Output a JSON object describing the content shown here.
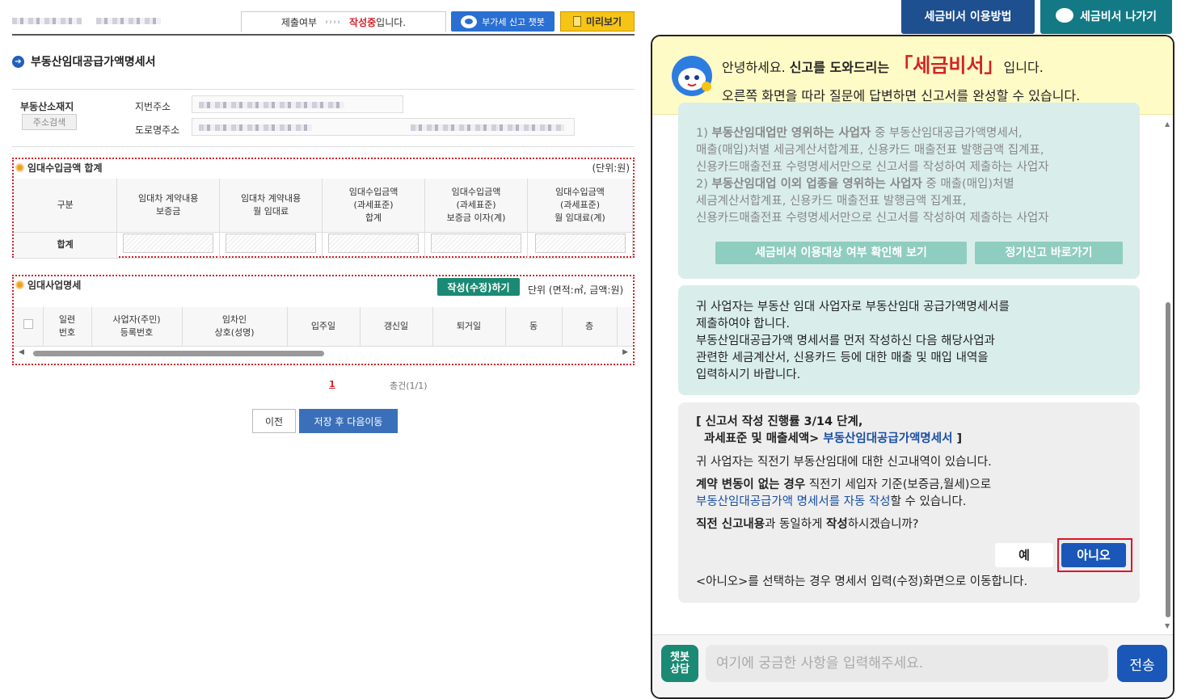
{
  "left": {
    "topbar": {
      "submit_label": "제출여부",
      "arrows": "››››",
      "status_red": "작성중",
      "status_suffix": "입니다.",
      "chatbot_button": "부가세 신고 챗봇",
      "preview_button": "미리보기"
    },
    "page_title": "부동산임대공급가액명세서",
    "address": {
      "location_label": "부동산소재지",
      "search_button": "주소검색",
      "lot_label": "지번주소",
      "road_label": "도로명주소"
    },
    "income_total": {
      "title": "임대수입금액 합계",
      "unit": "(단위:원)",
      "headers": [
        "구분",
        "임대차 계약내용\n보증금",
        "임대차 계약내용\n월 임대료",
        "임대수입금액\n(과세표준)\n합계",
        "임대수입금액\n(과세표준)\n보증금 이자(계)",
        "임대수입금액\n(과세표준)\n월 임대료(계)"
      ],
      "row_label": "합계"
    },
    "business_detail": {
      "title": "임대사업명세",
      "write_button": "작성(수정)하기",
      "unit": "단위 (면적:㎡, 금액:원)",
      "headers": [
        "일련\n번호",
        "사업자(주민)\n등록번호",
        "임차인\n상호(성명)",
        "입주일",
        "갱신일",
        "퇴거일",
        "동",
        "층"
      ]
    },
    "pagination": {
      "page": "1",
      "count": "총건(1/1)"
    },
    "prev_button": "이전",
    "next_button": "저장 후 다음이동"
  },
  "right": {
    "top_tabs": [
      "세금비서 이용방법",
      "세금비서 나가기"
    ],
    "banner": {
      "greet": "안녕하세요.",
      "bold": "신고를 도와드리는",
      "brand": "「세금비서」",
      "tail": "입니다.",
      "line2": "오른쪽 화면을 따라 질문에 답변하면 신고서를 완성할 수 있습니다."
    },
    "msg1": {
      "l1a": "1) ",
      "l1b": "부동산임대업만 영위하는 사업자",
      "l1c": " 중 부동산임대공급가액명세서,",
      "l2": "매출(매입)처별 세금계산서합계표, 신용카드 매출전표 발행금액 집계표,",
      "l3": "신용카드매출전표 수령명세서만으로 신고서를 작성하여 제출하는 사업자",
      "l4a": "2) ",
      "l4b": "부동산임대업 이외 업종을 영위하는 사업자",
      "l4c": " 중 매출(매입)처별",
      "l5": "세금계산서합계표, 신용카드 매출전표 발행금액 집계표,",
      "l6": "신용카드매출전표 수령명세서만으로 신고서를 작성하여 제출하는 사업자",
      "btn_check": "세금비서 이용대상 여부 확인해 보기",
      "btn_regular": "정기신고 바로가기"
    },
    "msg2": {
      "l1": "귀 사업자는 부동산 임대 사업자로 부동산임대 공급가액명세서를",
      "l2": "제출하여야 합니다.",
      "l3": "부동산임대공급가액 명세서를 먼저 작성하신 다음 해당사업과",
      "l4": "관련한 세금계산서, 신용카드 등에 대한 매출 및 매입 내역을",
      "l5": "입력하시기 바랍니다."
    },
    "msg3": {
      "step1": "[ 신고서 작성 진행률 3/14 단계,",
      "step2a": "과세표준 및 매출세액> ",
      "step2b": "부동산임대공급가액명세서",
      "step2c": " ]",
      "p1": "귀 사업자는 직전기 부동산임대에 대한 신고내역이 있습니다.",
      "p2a": "계약 변동이 없는 경우",
      "p2b": " 직전기 세입자 기준(보증금,월세)으로",
      "p3a": "부동산임대공급가액 명세서를 자동 작성",
      "p3b": "할 수 있습니다.",
      "p4a": "직전 신고내용",
      "p4b": "과 동일하게 ",
      "p4c": "작성",
      "p4d": "하시겠습니까?",
      "yes": "예",
      "no": "아니오",
      "note": "<아니오>를 선택하는 경우 명세서 입력(수정)화면으로 이동합니다."
    },
    "input": {
      "chat_label": "챗봇\n상담",
      "placeholder": "여기에 궁금한 사항을 입력해주세요.",
      "send": "전송"
    }
  }
}
